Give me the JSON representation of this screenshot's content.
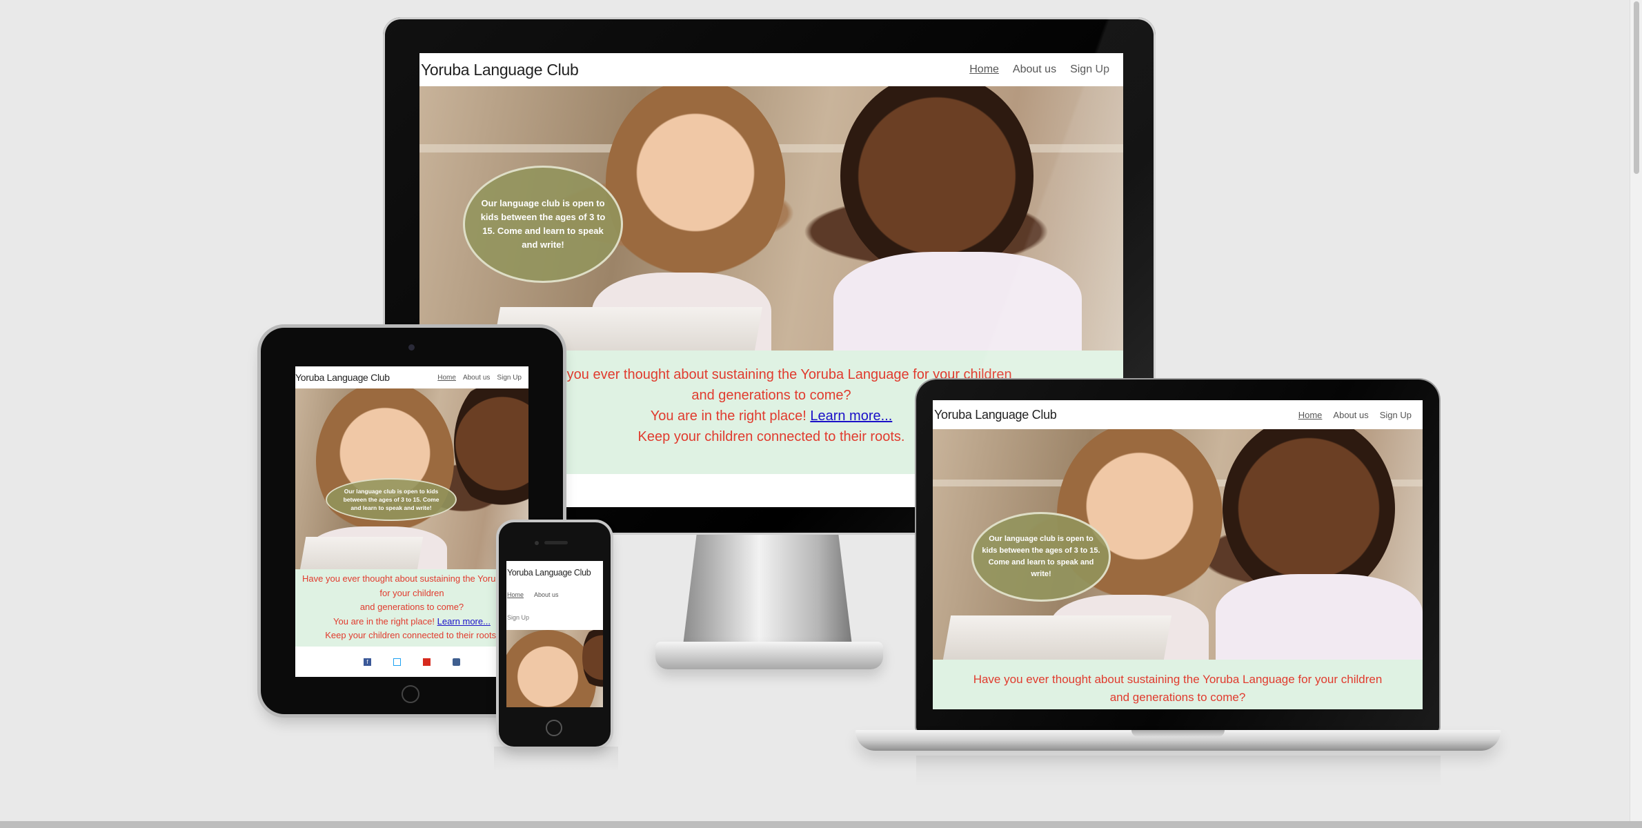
{
  "site": {
    "brand": "Yoruba Language Club",
    "nav": [
      "Home",
      "About us",
      "Sign Up"
    ],
    "bubble": "Our language club is open to kids between the ages of 3 to 15. Come and learn to speak and write!",
    "hero_line1": "Have you ever thought about sustaining the Yoruba Language for your children",
    "hero_line2": "and generations to come?",
    "hero_line3": "You are in the right place!",
    "hero_link": "Learn more...",
    "hero_line4": "Keep your children connected to their roots.",
    "tablet_line1a": "Have you ever thought about sustaining the Yoruba Lan",
    "tablet_line1b": "for your children",
    "desktop_line1_visible": "Have you ever thought about sustaining the Yoruba Language for your children"
  },
  "social_icons": [
    "facebook-icon",
    "twitter-icon",
    "youtube-icon",
    "instagram-icon"
  ],
  "colors": {
    "page_bg": "#e9e9e9",
    "hero_text": "#e03b2e",
    "hero_bg": "#dff2e3",
    "link": "#1a10c8",
    "bubble": "#92945c"
  }
}
